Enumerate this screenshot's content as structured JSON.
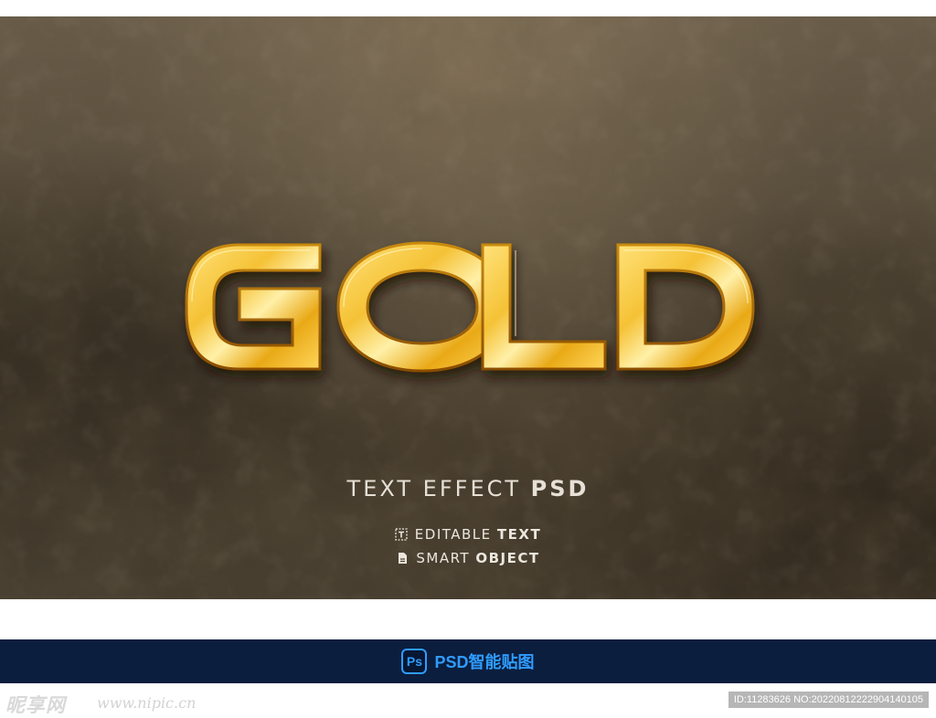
{
  "poster": {
    "headline": "GOLD",
    "tagline_regular": "TEXT EFFECT ",
    "tagline_bold": "PSD",
    "features": [
      {
        "icon": "editable-text-icon",
        "regular": "EDITABLE ",
        "bold": "TEXT"
      },
      {
        "icon": "smart-object-icon",
        "regular": "SMART ",
        "bold": "OBJECT"
      }
    ]
  },
  "banner": {
    "badge": "Ps",
    "label": "PSD智能贴图"
  },
  "watermark": {
    "logo": "昵享网",
    "url": "www.nipic.cn",
    "id_text": "ID:11283626 NO:20220812222904140105"
  },
  "colors": {
    "wall": "#4f4535",
    "gold_light": "#ffe27a",
    "gold_mid": "#f0b01c",
    "gold_dark": "#b06a05",
    "banner_bg": "#0b1e3e",
    "banner_accent": "#2f9cff"
  }
}
